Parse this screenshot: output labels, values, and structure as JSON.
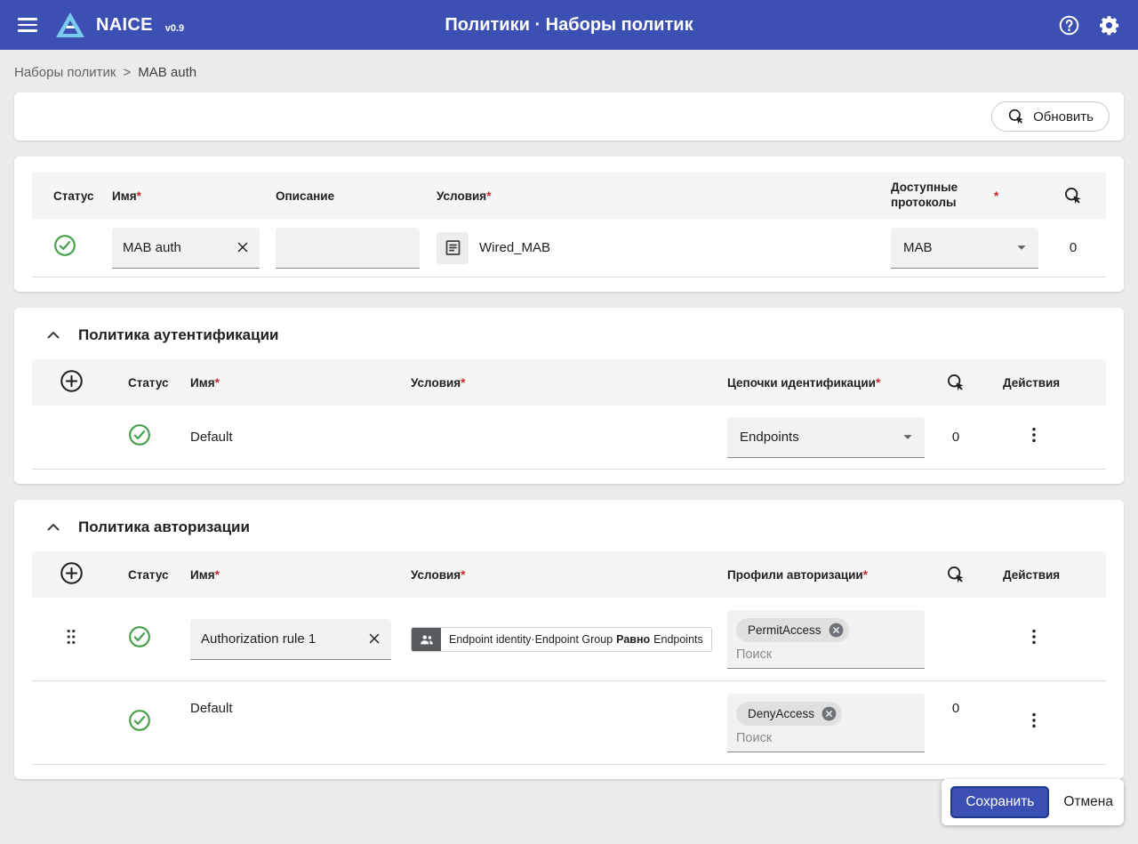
{
  "colors": {
    "appbar": "#3c50b4",
    "success": "#43a047",
    "required": "#c62828",
    "save_button": "#3c50b4"
  },
  "app_bar": {
    "title": "NAICE",
    "version": "v0.9",
    "page_title": "Политики · Наборы политик"
  },
  "breadcrumb": {
    "root": "Наборы политик",
    "separator": ">",
    "current": "MAB auth"
  },
  "toolbar": {
    "refresh_label": "Обновить"
  },
  "marks": {
    "required": "*"
  },
  "policy_set": {
    "headers": {
      "status": "Статус",
      "name": "Имя",
      "description": "Описание",
      "conditions": "Условия",
      "protocols": "Доступные протоколы"
    },
    "row": {
      "name_value": "MAB auth",
      "description_value": "",
      "condition_value": "Wired_MAB",
      "protocol_value": "MAB",
      "hits": "0"
    }
  },
  "auth_policy": {
    "title": "Политика аутентификации",
    "headers": {
      "status": "Статус",
      "name": "Имя",
      "conditions": "Условия",
      "identity": "Цепочки идентификации",
      "actions": "Действия"
    },
    "row": {
      "name": "Default",
      "identity_value": "Endpoints",
      "hits": "0"
    }
  },
  "authz_policy": {
    "title": "Политика авторизации",
    "headers": {
      "status": "Статус",
      "name": "Имя",
      "conditions": "Условия",
      "profiles": "Профили авторизации",
      "actions": "Действия"
    },
    "rows": [
      {
        "name_value": "Authorization rule 1",
        "condition": {
          "prefix": "Endpoint identity·Endpoint Group",
          "operator": "Равно",
          "value": "Endpoints"
        },
        "profile_chip": "PermitAccess",
        "search_placeholder": "Поиск"
      },
      {
        "name": "Default",
        "profile_chip": "DenyAccess",
        "search_placeholder": "Поиск",
        "hits": "0"
      }
    ]
  },
  "footer": {
    "save_label": "Сохранить",
    "cancel_label": "Отмена"
  }
}
